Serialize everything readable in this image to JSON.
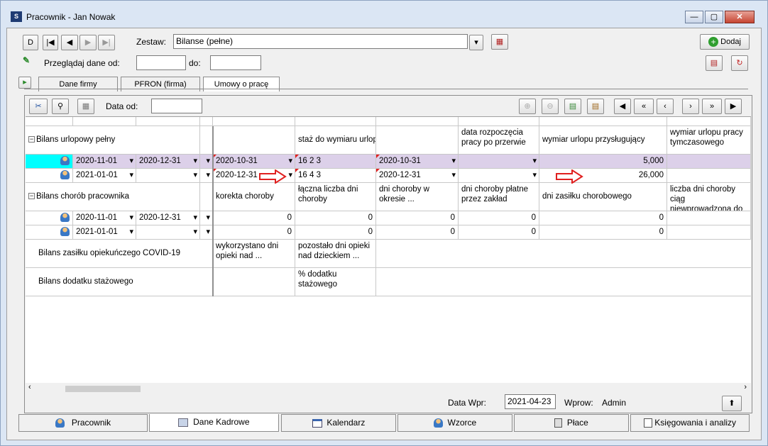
{
  "window": {
    "title": "Pracownik - Jan Nowak"
  },
  "toolbar": {
    "zestaw_label": "Zestaw:",
    "zestaw_value": "Bilanse (pełne)",
    "dodaj_label": "Dodaj",
    "przegladaj_label": "Przeglądaj dane od:",
    "do_label": "do:",
    "nav_first": "D"
  },
  "tabs": [
    "Dane firmy",
    "PFRON (firma)",
    "Umowy o pracę"
  ],
  "panel": {
    "data_od_label": "Data od:"
  },
  "grid": {
    "urlop": {
      "title": "Bilans urlopowy pełny",
      "col_headers": [
        "staż do wymiaru urlopu",
        "data rozpoczęcia pracy po przerwie",
        "wymiar urlopu przysługujący",
        "wymiar urlopu pracy tymczasowego"
      ],
      "rows": [
        {
          "from": "2020-11-01",
          "to": "2020-12-31",
          "c1": "2020-10-31",
          "c2": "16  2  3",
          "c3": "2020-10-31",
          "c4": "",
          "c5": "5,000"
        },
        {
          "from": "2021-01-01",
          "to": "",
          "c1": "2020-12-31",
          "c2": "16  4  3",
          "c3": "2020-12-31",
          "c4": "",
          "c5": "26,000"
        }
      ]
    },
    "choroby": {
      "title": "Bilans chorób pracownika",
      "col_headers": [
        "korekta choroby",
        "łączna liczba dni choroby",
        "dni choroby w okresie ...",
        "dni choroby płatne przez zakład",
        "dni zasiłku chorobowego",
        "liczba dni choroby ciąg niewprowadzona do"
      ],
      "rows": [
        {
          "from": "2020-11-01",
          "to": "2020-12-31",
          "v": [
            "0",
            "0",
            "0",
            "0",
            "0"
          ]
        },
        {
          "from": "2021-01-01",
          "to": "",
          "v": [
            "0",
            "0",
            "0",
            "0",
            "0"
          ]
        }
      ]
    },
    "covid": {
      "title": "Bilans zasiłku opiekuńczego COVID-19",
      "col_headers": [
        "wykorzystano dni opieki nad ...",
        "pozostało dni opieki nad dzieckiem ..."
      ]
    },
    "stazowy": {
      "title": "Bilans dodatku stażowego",
      "col_headers": [
        "% dodatku stażowego"
      ]
    }
  },
  "footer": {
    "data_wpr_label": "Data Wpr:",
    "data_wpr_value": "2021-04-23",
    "wprow_label": "Wprow:",
    "wprow_value": "Admin"
  },
  "bottom_tabs": [
    "Pracownik",
    "Dane Kadrowe",
    "Kalendarz",
    "Wzorce",
    "Płace",
    "Księgowania i analizy"
  ]
}
